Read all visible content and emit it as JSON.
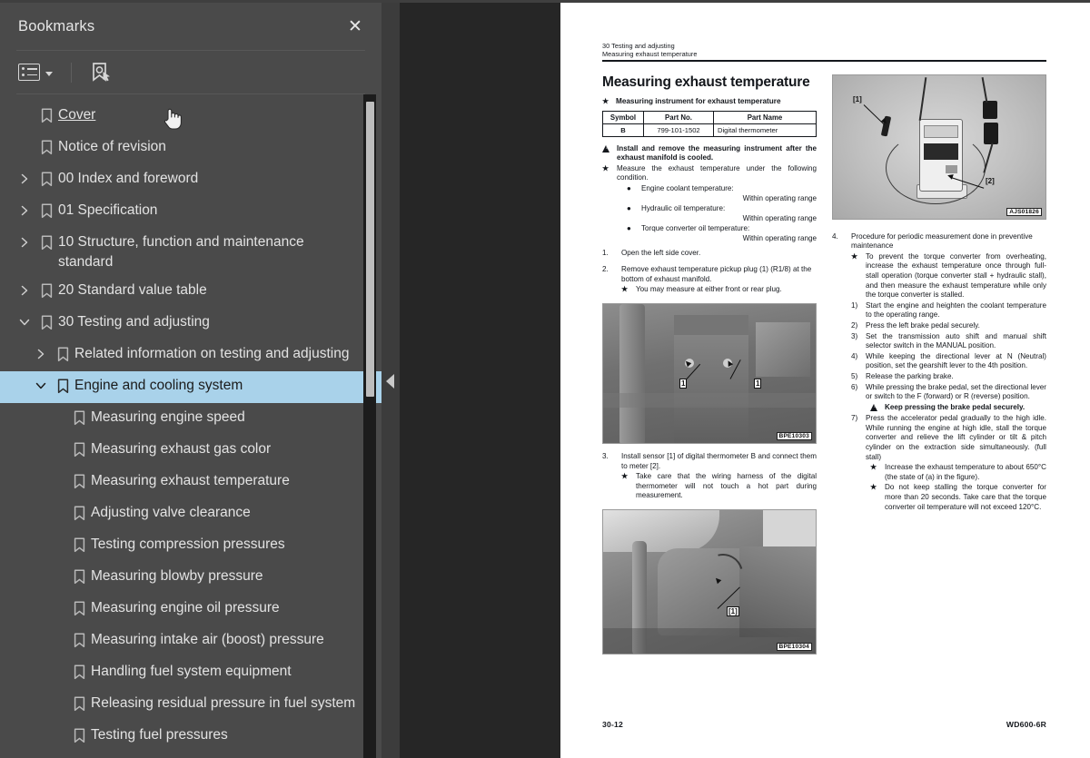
{
  "sidebar": {
    "title": "Bookmarks",
    "close_icon": "close-icon",
    "toolbar": {
      "options_icon": "list-options-icon",
      "options_caret": "chevron-down-icon",
      "new_bookmark_icon": "new-bookmark-icon"
    },
    "items": [
      {
        "label": "Cover",
        "level": 0,
        "twisty": "none",
        "state": "hover"
      },
      {
        "label": "Notice of revision",
        "level": 0,
        "twisty": "none",
        "state": "normal"
      },
      {
        "label": "00 Index and foreword",
        "level": 0,
        "twisty": "collapsed",
        "state": "normal"
      },
      {
        "label": "01 Specification",
        "level": 0,
        "twisty": "collapsed",
        "state": "normal"
      },
      {
        "label": "10 Structure, function and maintenance standard",
        "level": 0,
        "twisty": "collapsed",
        "state": "normal"
      },
      {
        "label": "20 Standard value table",
        "level": 0,
        "twisty": "collapsed",
        "state": "normal"
      },
      {
        "label": "30 Testing and adjusting",
        "level": 0,
        "twisty": "expanded",
        "state": "normal"
      },
      {
        "label": "Related information on testing and adjusting",
        "level": 1,
        "twisty": "collapsed",
        "state": "normal"
      },
      {
        "label": "Engine and cooling system",
        "level": 1,
        "twisty": "expanded",
        "state": "selected"
      },
      {
        "label": "Measuring engine speed",
        "level": 2,
        "twisty": "none",
        "state": "normal"
      },
      {
        "label": "Measuring exhaust gas color",
        "level": 2,
        "twisty": "none",
        "state": "normal"
      },
      {
        "label": "Measuring exhaust temperature",
        "level": 2,
        "twisty": "none",
        "state": "normal"
      },
      {
        "label": "Adjusting valve clearance",
        "level": 2,
        "twisty": "none",
        "state": "normal"
      },
      {
        "label": "Testing compression pressures",
        "level": 2,
        "twisty": "none",
        "state": "normal"
      },
      {
        "label": "Measuring blowby pressure",
        "level": 2,
        "twisty": "none",
        "state": "normal"
      },
      {
        "label": "Measuring engine oil pressure",
        "level": 2,
        "twisty": "none",
        "state": "normal"
      },
      {
        "label": "Measuring intake air (boost) pressure",
        "level": 2,
        "twisty": "none",
        "state": "normal"
      },
      {
        "label": "Handling fuel system equipment",
        "level": 2,
        "twisty": "none",
        "state": "normal"
      },
      {
        "label": "Releasing residual pressure in fuel system",
        "level": 2,
        "twisty": "none",
        "state": "normal"
      },
      {
        "label": "Testing fuel pressures",
        "level": 2,
        "twisty": "none",
        "state": "normal"
      }
    ],
    "selection_color": "#a9d2ea",
    "background_color": "#4a4a4a",
    "scrollbar": {
      "thumb_color": "#bdbdbd",
      "track_color": "#1c1c1c"
    }
  },
  "divider": {
    "collapse_icon": "collapse-left-arrow-icon"
  },
  "viewer": {
    "background_color": "#262626"
  },
  "page": {
    "header": {
      "line1": "30 Testing and adjusting",
      "line2": "Measuring exhaust temperature"
    },
    "title": "Measuring exhaust temperature",
    "subtitle_marker": "★",
    "subtitle": "Measuring instrument for exhaust temperature",
    "table": {
      "headers": [
        "Symbol",
        "Part No.",
        "Part Name"
      ],
      "rows": [
        [
          "B",
          "799-101-1502",
          "Digital thermometer"
        ]
      ]
    },
    "left_column": {
      "warning1": "Install and remove the measuring instrument after the exhaust manifold is cooled.",
      "note1": "Measure the exhaust temperature under the following condition.",
      "conditions": [
        {
          "label": "Engine coolant temperature:",
          "value": "Within operating range"
        },
        {
          "label": "Hydraulic oil temperature:",
          "value": "Within operating range"
        },
        {
          "label": "Torque converter oil temperature:",
          "value": "Within operating range"
        }
      ],
      "step1_num": "1.",
      "step1": "Open the left side cover.",
      "step2_num": "2.",
      "step2": "Remove exhaust temperature pickup plug (1) (R1/8) at the bottom of exhaust manifold.",
      "step2_note": "You may measure at either front or rear plug.",
      "step3_num": "3.",
      "step3": "Install sensor [1] of digital thermometer B and connect them to meter [2].",
      "step3_note": "Take care that the wiring harness of the digital thermometer will not touch a hot part during measurement."
    },
    "right_column": {
      "step4_num": "4.",
      "step4": "Procedure for periodic measurement done in preventive maintenance",
      "step4_note": "To prevent the torque converter from overheating, increase the exhaust temperature once through full-stall operation (torque converter stall + hydraulic stall), and then measure the exhaust temperature while only the torque converter is stalled.",
      "substeps": [
        {
          "num": "1)",
          "text": "Start the engine and heighten the coolant temperature to the operating range."
        },
        {
          "num": "2)",
          "text": "Press the left brake pedal securely."
        },
        {
          "num": "3)",
          "text": "Set the transmission auto shift and manual shift selector switch in the MANUAL position."
        },
        {
          "num": "4)",
          "text": "While keeping the directional lever at N (Neutral) position, set the gearshift lever to the 4th position."
        },
        {
          "num": "5)",
          "text": "Release the parking brake."
        },
        {
          "num": "6)",
          "text": "While pressing the brake pedal, set the directional lever or switch to the F (forward) or R (reverse) position."
        }
      ],
      "warning2": "Keep pressing the brake pedal securely.",
      "substep7_num": "7)",
      "substep7": "Press the accelerator pedal gradually to the high idle. While running the engine at high idle, stall the torque converter and relieve the lift cylinder or tilt & pitch cylinder on the extraction side simultaneously. (full stall)",
      "note_a": "Increase the exhaust temperature to about 650°C (the state of (a) in the figure).",
      "note_b": "Do not keep stalling the torque converter for more than 20 seconds. Take care that the torque converter oil temperature will not exceed 120°C."
    },
    "figures": [
      {
        "code": "AJS01826",
        "callout1": "[1]",
        "callout2": "[2]",
        "name": "digital-thermometer-photo"
      },
      {
        "code": "BPE10303",
        "callout1": "1",
        "callout2": "1",
        "name": "exhaust-manifold-photo"
      },
      {
        "code": "BPE10304",
        "callout1": "[1]",
        "callout2": "",
        "name": "sensor-installed-photo"
      }
    ],
    "footer": {
      "page_number": "30-12",
      "model": "WD600-6R"
    }
  }
}
